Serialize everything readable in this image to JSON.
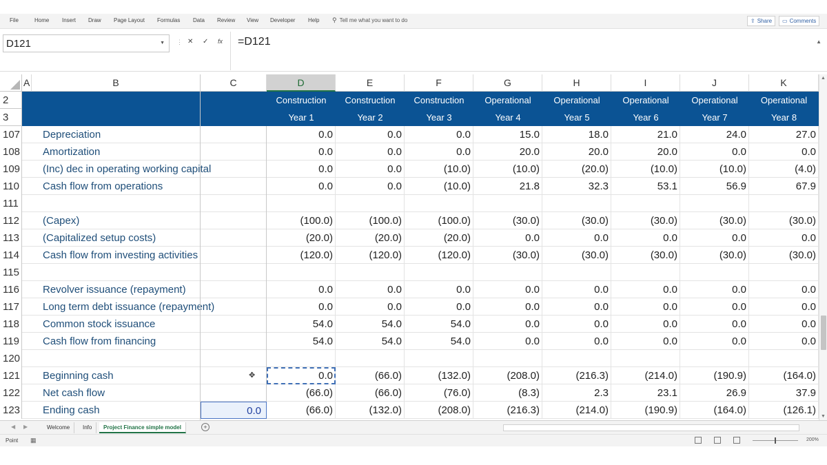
{
  "menu": {
    "items": [
      "File",
      "Home",
      "Insert",
      "Draw",
      "Page Layout",
      "Formulas",
      "Data",
      "Review",
      "View",
      "Developer",
      "Help"
    ],
    "tell_me": "Tell me what you want to do",
    "share": "Share",
    "comments": "Comments"
  },
  "formula_bar": {
    "name_box": "D121",
    "formula": "=D121",
    "fx": "fx"
  },
  "columns": [
    "A",
    "B",
    "C",
    "D",
    "E",
    "F",
    "G",
    "H",
    "I",
    "J",
    "K"
  ],
  "header_rows": {
    "row2": {
      "num": "2",
      "values": [
        "Construction",
        "Construction",
        "Construction",
        "Operational",
        "Operational",
        "Operational",
        "Operational",
        "Operational"
      ]
    },
    "row3": {
      "num": "3",
      "values": [
        "Year 1",
        "Year 2",
        "Year 3",
        "Year 4",
        "Year 5",
        "Year 6",
        "Year 7",
        "Year 8"
      ]
    }
  },
  "rows": [
    {
      "num": "107",
      "label": "Depreciation",
      "c": "",
      "values": [
        "0.0",
        "0.0",
        "0.0",
        "15.0",
        "18.0",
        "21.0",
        "24.0",
        "27.0"
      ]
    },
    {
      "num": "108",
      "label": "Amortization",
      "c": "",
      "values": [
        "0.0",
        "0.0",
        "0.0",
        "20.0",
        "20.0",
        "20.0",
        "0.0",
        "0.0"
      ]
    },
    {
      "num": "109",
      "label": "(Inc) dec in operating working capital",
      "c": "",
      "values": [
        "0.0",
        "0.0",
        "(10.0)",
        "(10.0)",
        "(20.0)",
        "(10.0)",
        "(10.0)",
        "(4.0)"
      ]
    },
    {
      "num": "110",
      "label": "Cash flow from operations",
      "c": "",
      "values": [
        "0.0",
        "0.0",
        "(10.0)",
        "21.8",
        "32.3",
        "53.1",
        "56.9",
        "67.9"
      ]
    },
    {
      "num": "111",
      "label": "",
      "c": "",
      "values": [
        "",
        "",
        "",
        "",
        "",
        "",
        "",
        ""
      ]
    },
    {
      "num": "112",
      "label": "(Capex)",
      "c": "",
      "values": [
        "(100.0)",
        "(100.0)",
        "(100.0)",
        "(30.0)",
        "(30.0)",
        "(30.0)",
        "(30.0)",
        "(30.0)"
      ]
    },
    {
      "num": "113",
      "label": "(Capitalized setup costs)",
      "c": "",
      "values": [
        "(20.0)",
        "(20.0)",
        "(20.0)",
        "0.0",
        "0.0",
        "0.0",
        "0.0",
        "0.0"
      ]
    },
    {
      "num": "114",
      "label": "Cash flow from investing activities",
      "c": "",
      "values": [
        "(120.0)",
        "(120.0)",
        "(120.0)",
        "(30.0)",
        "(30.0)",
        "(30.0)",
        "(30.0)",
        "(30.0)"
      ]
    },
    {
      "num": "115",
      "label": "",
      "c": "",
      "values": [
        "",
        "",
        "",
        "",
        "",
        "",
        "",
        ""
      ]
    },
    {
      "num": "116",
      "label": "Revolver issuance (repayment)",
      "c": "",
      "values": [
        "0.0",
        "0.0",
        "0.0",
        "0.0",
        "0.0",
        "0.0",
        "0.0",
        "0.0"
      ]
    },
    {
      "num": "117",
      "label": "Long term debt issuance (repayment)",
      "c": "",
      "values": [
        "0.0",
        "0.0",
        "0.0",
        "0.0",
        "0.0",
        "0.0",
        "0.0",
        "0.0"
      ]
    },
    {
      "num": "118",
      "label": "Common stock issuance",
      "c": "",
      "values": [
        "54.0",
        "54.0",
        "54.0",
        "0.0",
        "0.0",
        "0.0",
        "0.0",
        "0.0"
      ]
    },
    {
      "num": "119",
      "label": "Cash flow from financing",
      "c": "",
      "values": [
        "54.0",
        "54.0",
        "54.0",
        "0.0",
        "0.0",
        "0.0",
        "0.0",
        "0.0"
      ]
    },
    {
      "num": "120",
      "label": "",
      "c": "",
      "values": [
        "",
        "",
        "",
        "",
        "",
        "",
        "",
        ""
      ]
    },
    {
      "num": "121",
      "label": "Beginning cash",
      "c": "",
      "values": [
        "0.0",
        "(66.0)",
        "(132.0)",
        "(208.0)",
        "(216.3)",
        "(214.0)",
        "(190.9)",
        "(164.0)"
      ]
    },
    {
      "num": "122",
      "label": "Net cash flow",
      "c": "",
      "values": [
        "(66.0)",
        "(66.0)",
        "(76.0)",
        "(8.3)",
        "2.3",
        "23.1",
        "26.9",
        "37.9"
      ]
    },
    {
      "num": "123",
      "label": "Ending cash",
      "c": "0.0",
      "values": [
        "(66.0)",
        "(132.0)",
        "(208.0)",
        "(216.3)",
        "(214.0)",
        "(190.9)",
        "(164.0)",
        "(126.1)"
      ]
    }
  ],
  "sheet_tabs": [
    "Welcome",
    "Info",
    "Project Finance simple model"
  ],
  "active_tab": "Project Finance simple model",
  "status": {
    "mode": "Point",
    "zoom": "200%"
  },
  "colors": {
    "banner": "#0b5394",
    "label_text": "#1f4e79",
    "accent": "#217346"
  }
}
